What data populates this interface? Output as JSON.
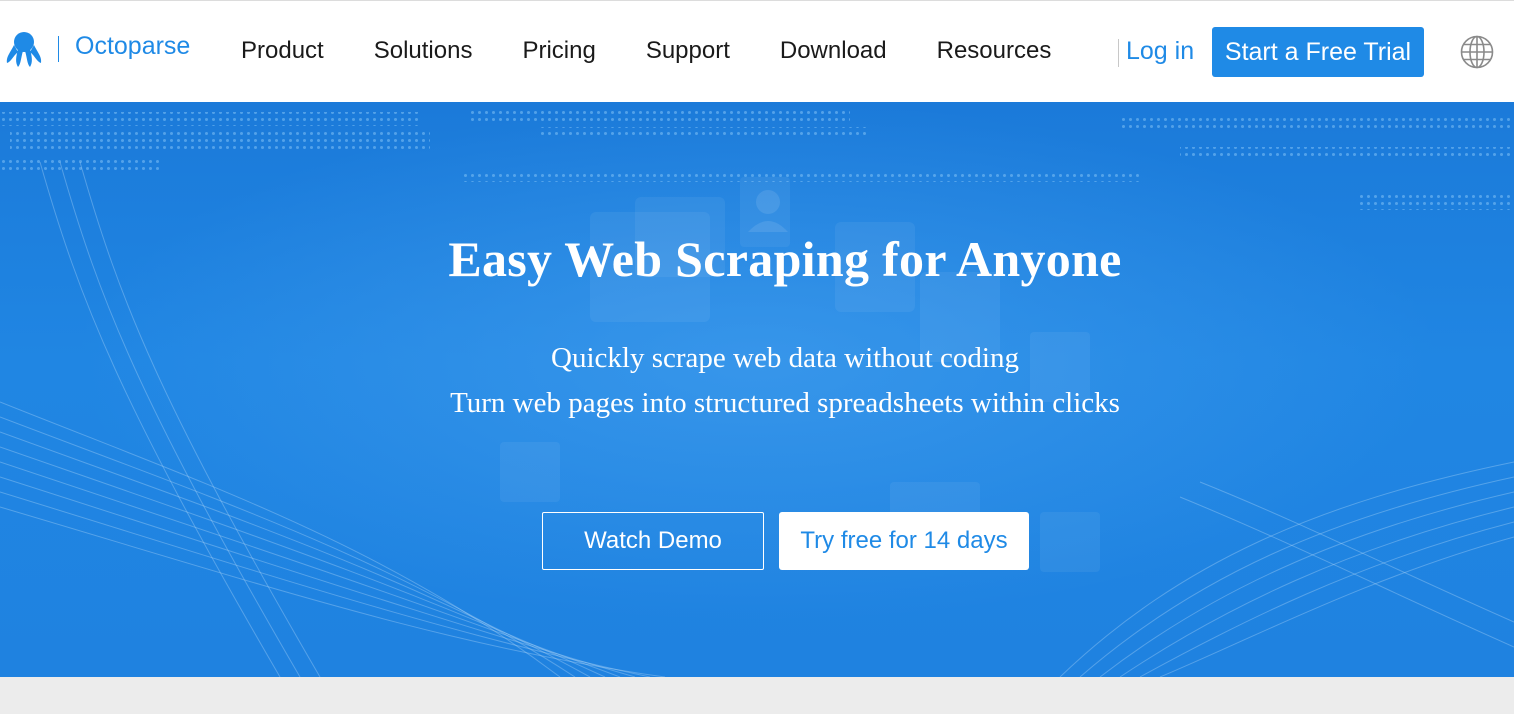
{
  "brand": {
    "name": "Octoparse",
    "color": "#1f8ae6"
  },
  "nav": {
    "items": [
      {
        "label": "Product"
      },
      {
        "label": "Solutions"
      },
      {
        "label": "Pricing"
      },
      {
        "label": "Support"
      },
      {
        "label": "Download"
      },
      {
        "label": "Resources"
      }
    ],
    "login_label": "Log in",
    "trial_label": "Start a Free Trial",
    "language_icon": "globe-icon"
  },
  "hero": {
    "title": "Easy Web Scraping for Anyone",
    "subtitle_line1": "Quickly scrape web data without coding",
    "subtitle_line2": "Turn web pages into structured spreadsheets within clicks",
    "demo_label": "Watch Demo",
    "free_label": "Try free for 14 days",
    "background_color": "#1f82e0"
  }
}
